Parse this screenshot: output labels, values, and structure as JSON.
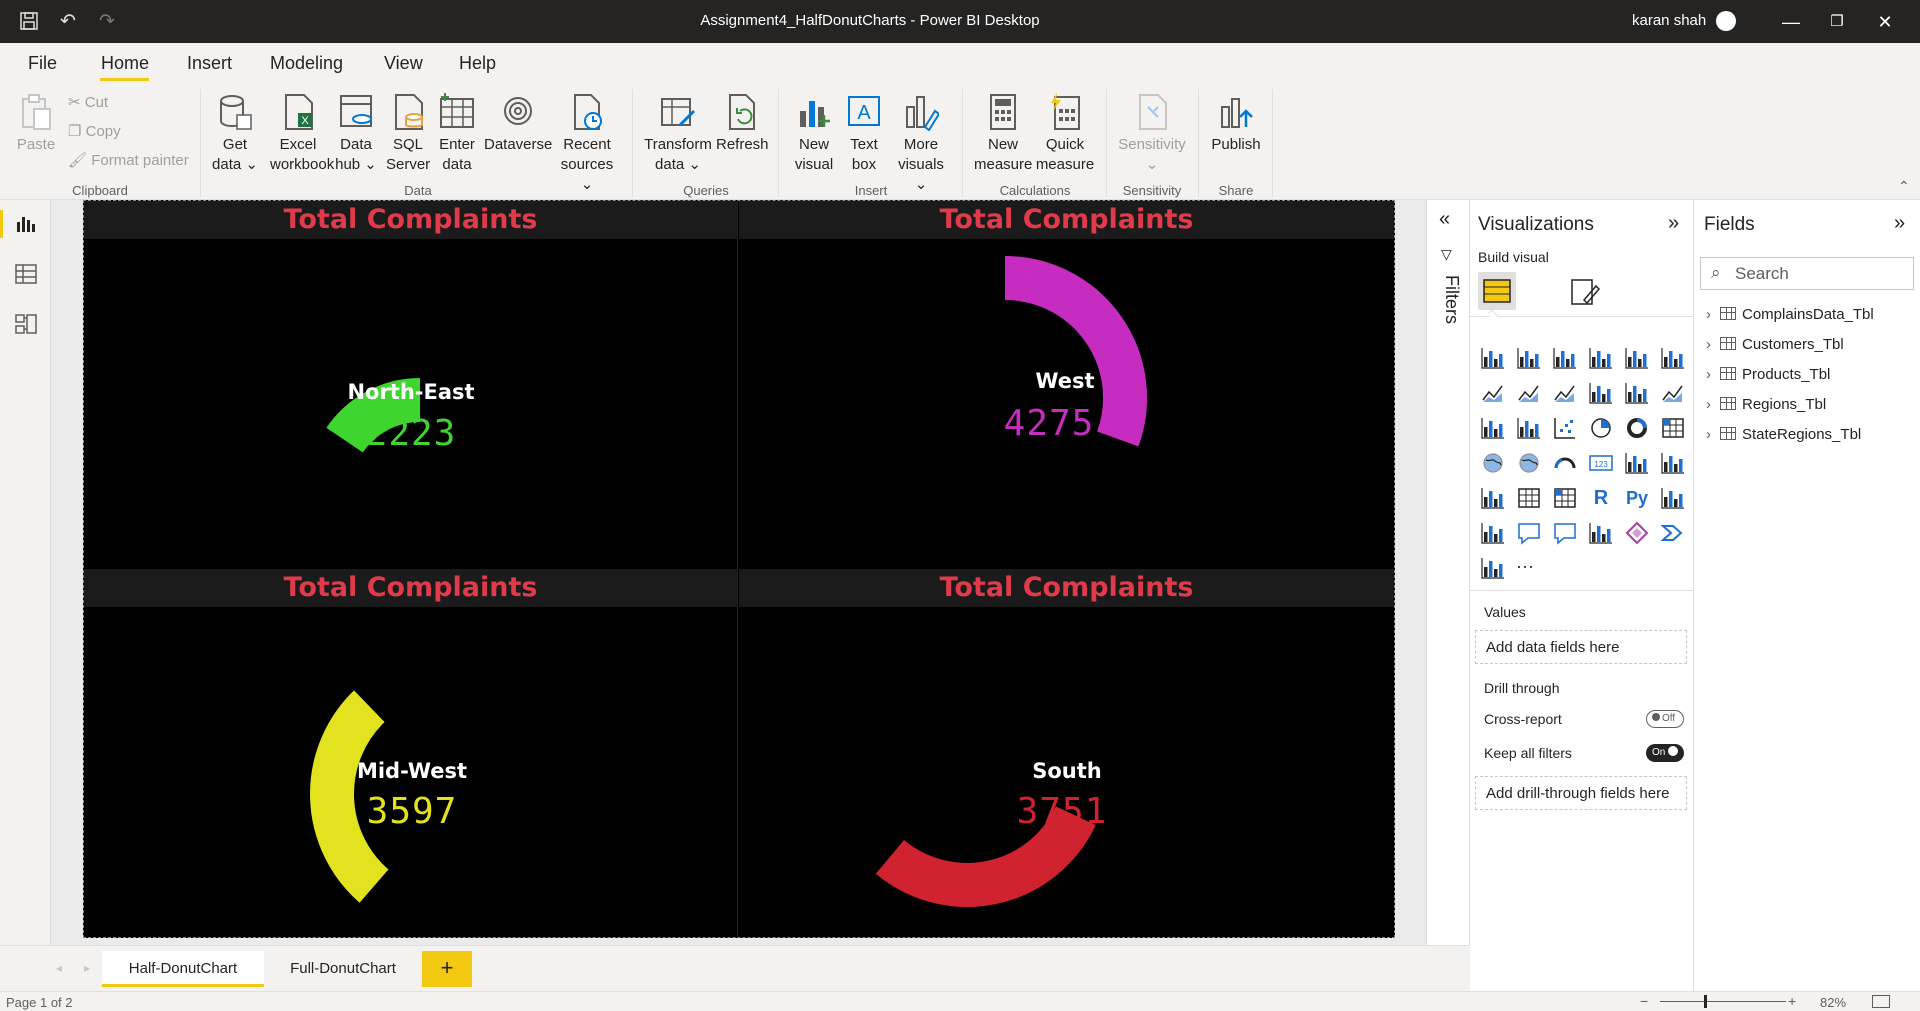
{
  "titlebar": {
    "title": "Assignment4_HalfDonutCharts - Power BI Desktop",
    "user": "karan shah",
    "minimize": "—",
    "restore": "❐",
    "close": "✕"
  },
  "menu": {
    "items": [
      "File",
      "Home",
      "Insert",
      "Modeling",
      "View",
      "Help"
    ],
    "active": "Home"
  },
  "ribbon": {
    "clipboard": {
      "paste": "Paste",
      "cut": "Cut",
      "copy": "Copy",
      "format_painter": "Format painter",
      "label": "Clipboard"
    },
    "data": {
      "get_data": [
        "Get",
        "data"
      ],
      "excel": [
        "Excel",
        "workbook"
      ],
      "data_hub": [
        "Data",
        "hub"
      ],
      "sql": [
        "SQL",
        "Server"
      ],
      "enter": [
        "Enter",
        "data"
      ],
      "dataverse": "Dataverse",
      "recent": [
        "Recent",
        "sources"
      ],
      "label": "Data"
    },
    "queries": {
      "transform": [
        "Transform",
        "data"
      ],
      "refresh": "Refresh",
      "label": "Queries"
    },
    "insert": {
      "new_visual": [
        "New",
        "visual"
      ],
      "text_box": [
        "Text",
        "box"
      ],
      "more_visuals": [
        "More",
        "visuals"
      ],
      "label": "Insert"
    },
    "calculations": {
      "new_measure": [
        "New",
        "measure"
      ],
      "quick_measure": [
        "Quick",
        "measure"
      ],
      "label": "Calculations"
    },
    "sensitivity": {
      "button": "Sensitivity",
      "label": "Sensitivity"
    },
    "share": {
      "publish": "Publish",
      "label": "Share"
    }
  },
  "visuals": [
    {
      "header": "Total Complaints",
      "region": "North-East",
      "value": "2223",
      "color": "#3fd52f",
      "fraction": 0.2223
    },
    {
      "header": "Total Complaints",
      "region": "West",
      "value": "4275",
      "color": "#c52cbf",
      "fraction": 0.4275
    },
    {
      "header": "Total Complaints",
      "region": "Mid-West",
      "value": "3597",
      "color": "#e2e21f",
      "fraction": 0.3597
    },
    {
      "header": "Total Complaints",
      "region": "South",
      "value": "3751",
      "color": "#d1222f",
      "fraction": 0.3751
    }
  ],
  "filters": {
    "label": "Filters"
  },
  "visualizations": {
    "title": "Visualizations",
    "build_visual": "Build visual",
    "values_label": "Values",
    "values_placeholder": "Add data fields here",
    "drill_through": "Drill through",
    "cross_report": "Cross-report",
    "cross_report_state": "Off",
    "keep_filters": "Keep all filters",
    "keep_filters_state": "On",
    "drill_placeholder": "Add drill-through fields here",
    "more": "···"
  },
  "fields": {
    "title": "Fields",
    "search_placeholder": "Search",
    "tables": [
      "ComplainsData_Tbl",
      "Customers_Tbl",
      "Products_Tbl",
      "Regions_Tbl",
      "StateRegions_Tbl"
    ]
  },
  "tabs": {
    "pages": [
      "Half-DonutChart",
      "Full-DonutChart"
    ],
    "active": "Half-DonutChart",
    "add": "+"
  },
  "status": {
    "page": "Page 1 of 2",
    "zoom": "82%"
  }
}
